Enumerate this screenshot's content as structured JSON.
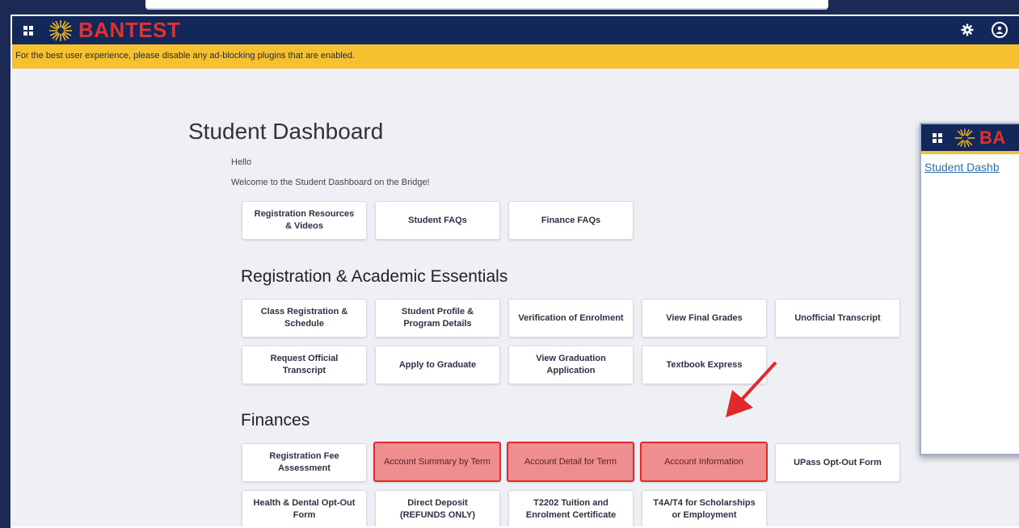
{
  "app": {
    "brand": "BANTEST",
    "warning": "For the best user experience, please disable any ad-blocking plugins that are enabled."
  },
  "dashboard": {
    "title": "Student Dashboard",
    "hello": "Hello",
    "welcome": "Welcome to the Student Dashboard on the Bridge!",
    "quick_links": [
      "Registration Resources & Videos",
      "Student FAQs",
      "Finance FAQs"
    ]
  },
  "registration": {
    "title": "Registration & Academic Essentials",
    "items": [
      "Class Registration & Schedule",
      "Student Profile & Program Details",
      "Verification of Enrolment",
      "View Final Grades",
      "Unofficial Transcript",
      "Request Official Transcript",
      "Apply to Graduate",
      "View Graduation Application",
      "Textbook Express"
    ]
  },
  "finances": {
    "title": "Finances",
    "items": [
      "Registration Fee Assessment",
      "Account Summary by Term",
      "Account Detail for Term",
      "Account Information",
      "UPass Opt-Out Form",
      "Health & Dental Opt-Out Form",
      "Direct Deposit (REFUNDS ONLY)",
      "T2202 Tuition and Enrolment Certificate",
      "T4A/T4 for Scholarships or Employment"
    ]
  },
  "popup": {
    "brand": "BA",
    "link": "Student Dashb"
  },
  "colors": {
    "navy": "#12275a",
    "warning": "#f6c12e",
    "brand_red": "#e6302c",
    "highlight_fill": "#ef8e8f",
    "highlight_border": "#e02a2a",
    "arrow": "#e02a2a"
  },
  "icons": [
    "grid-icon",
    "sun-logo-icon",
    "gear-icon",
    "user-icon",
    "red-arrow-icon"
  ]
}
